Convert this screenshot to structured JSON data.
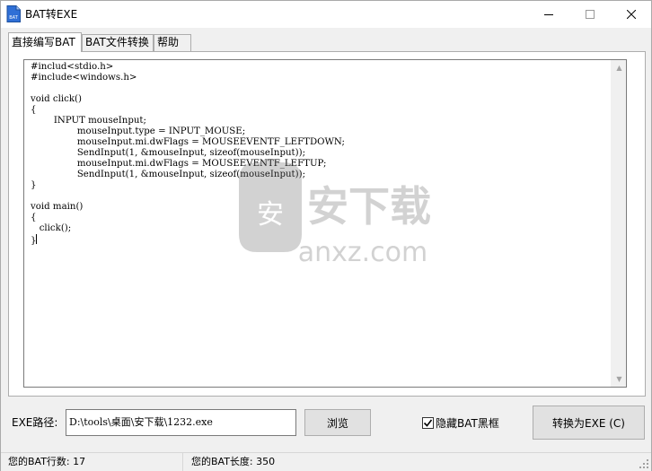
{
  "window": {
    "title": "BAT转EXE",
    "icon": "bat-file-icon",
    "icon_text": "BAT"
  },
  "tabs": [
    {
      "label": "直接编写BAT",
      "active": true
    },
    {
      "label": "BAT文件转换",
      "active": false
    },
    {
      "label": "帮助",
      "active": false
    }
  ],
  "editor": {
    "lines": [
      "#includ<stdio.h>",
      "#include<windows.h>",
      "",
      "void click()",
      "{",
      "        INPUT mouseInput;",
      "                mouseInput.type = INPUT_MOUSE;",
      "                mouseInput.mi.dwFlags = MOUSEEVENTF_LEFTDOWN;",
      "                SendInput(1, &mouseInput, sizeof(mouseInput));",
      "                mouseInput.mi.dwFlags = MOUSEEVENTF_LEFTUP;",
      "                SendInput(1, &mouseInput, sizeof(mouseInput));",
      "}",
      "",
      "void main()",
      "{",
      "   click();",
      "}"
    ]
  },
  "watermark": {
    "badge_char": "安",
    "text": "安下载",
    "subtext": "anxz.com"
  },
  "controls": {
    "exe_path_label": "EXE路径:",
    "exe_path_value": "D:\\tools\\桌面\\安下载\\1232.exe",
    "browse_label": "浏览",
    "hide_bat_label": "隐藏BAT黑框",
    "hide_bat_checked": true,
    "convert_label": "转换为EXE (C)"
  },
  "status": {
    "lines_text": "您的BAT行数: 17",
    "length_text": "您的BAT长度: 350"
  }
}
